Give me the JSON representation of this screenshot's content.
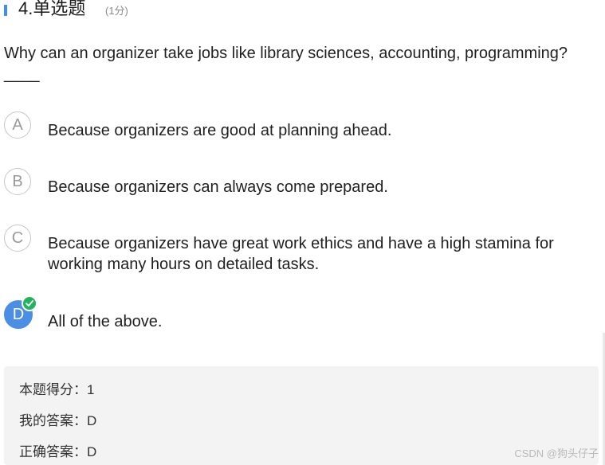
{
  "question": {
    "number_type": "4.单选题",
    "score_label": "(1分)",
    "text": "Why can an organizer take jobs like library sciences, accounting, programming?____"
  },
  "options": [
    {
      "letter": "A",
      "text": "Because organizers are good at planning ahead.",
      "selected": false
    },
    {
      "letter": "B",
      "text": "Because organizers can always come prepared.",
      "selected": false
    },
    {
      "letter": "C",
      "text": "Because organizers have great work ethics and have a high stamina for working many hours on detailed tasks.",
      "selected": false
    },
    {
      "letter": "D",
      "text": "All of the above.",
      "selected": true
    }
  ],
  "result": {
    "score_line": "本题得分：1",
    "my_answer_line": "我的答案：D",
    "correct_answer_line": "正确答案：D"
  },
  "watermark": "CSDN @狗头仔子",
  "colors": {
    "accent": "#3f8ef0",
    "selected_option": "#4a8ee6",
    "check_badge": "#22b35e",
    "result_background": "#f3f3f3"
  },
  "icons": {
    "check": "check-icon"
  }
}
